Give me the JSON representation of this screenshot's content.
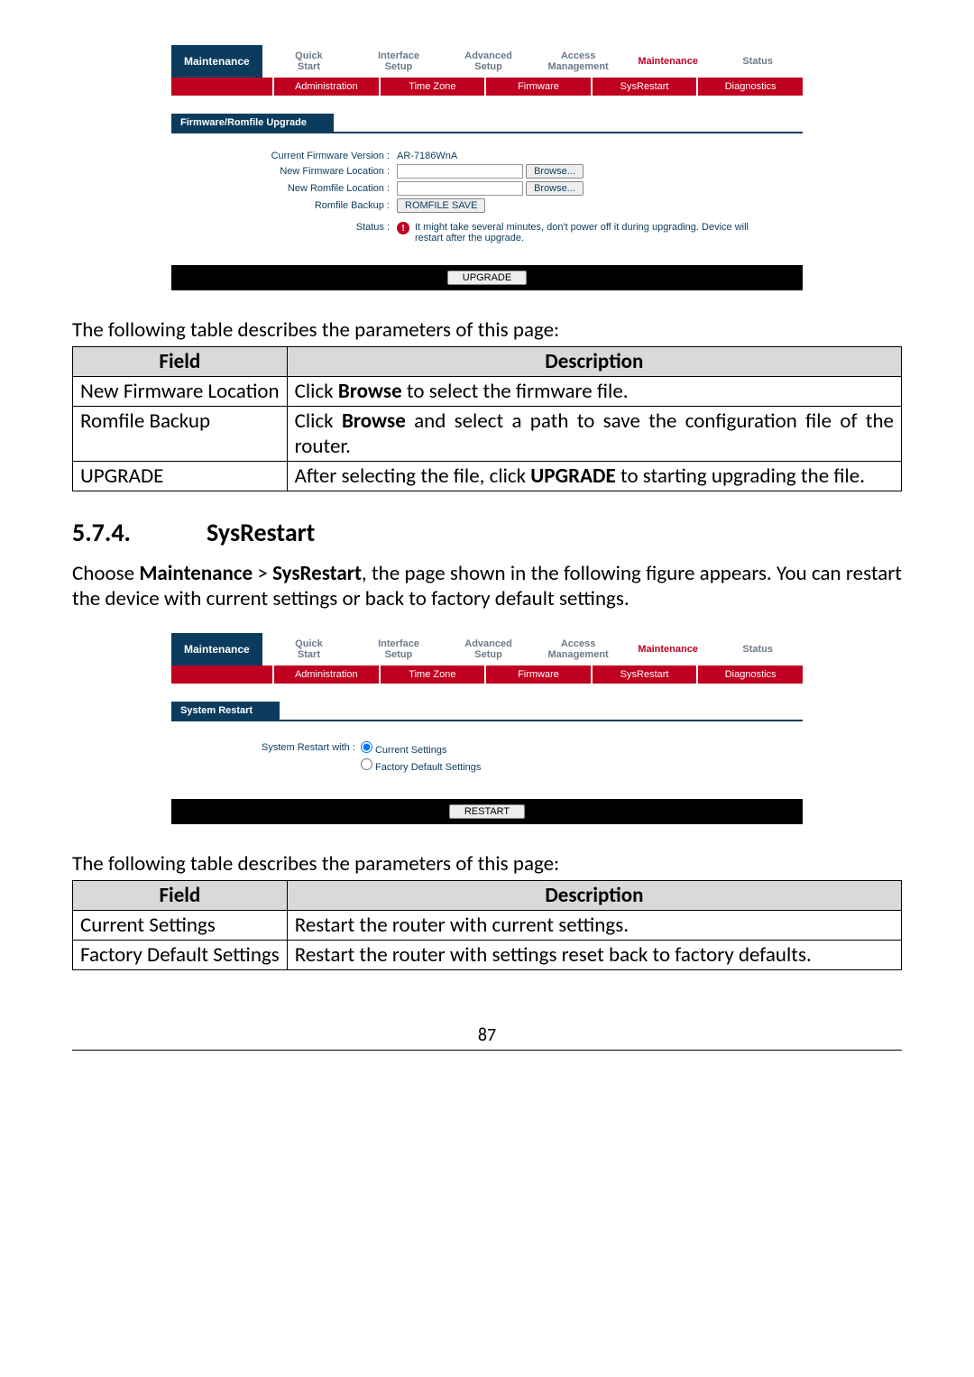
{
  "page_number": "87",
  "fw_ui": {
    "sidebar": "Maintenance",
    "tabs": [
      "Quick\nStart",
      "Interface\nSetup",
      "Advanced\nSetup",
      "Access\nManagement",
      "Maintenance",
      "Status"
    ],
    "tabs_active_index": 4,
    "subtabs": [
      "Administration",
      "Time Zone",
      "Firmware",
      "SysRestart",
      "Diagnostics"
    ],
    "section_title": "Firmware/Romfile Upgrade",
    "rows": {
      "current_version_label": "Current Firmware Version :",
      "current_version_value": "AR-7186WnA",
      "new_fw_label": "New Firmware Location :",
      "new_romfile_label": "New Romfile Location :",
      "romfile_backup_label": "Romfile Backup :",
      "status_label": "Status :",
      "browse_btn": "Browse...",
      "romfile_save_btn": "ROMFILE SAVE",
      "status_msg": "It might take several minutes, don't power off it during upgrading. Device will restart after the upgrade."
    },
    "upgrade_btn": "UPGRADE"
  },
  "intro1": "The following table describes the parameters of this page:",
  "table1": {
    "headers": [
      "Field",
      "Description"
    ],
    "rows": [
      {
        "field": "New Firmware Location",
        "desc_pre": "Click ",
        "desc_bold": "Browse",
        "desc_post": " to select the firmware file."
      },
      {
        "field": "Romfile Backup",
        "desc_pre": "Click ",
        "desc_bold": "Browse",
        "desc_post": " and select a path to save the configuration file of the router."
      },
      {
        "field": "UPGRADE",
        "desc_pre": "After selecting the file, click ",
        "desc_bold": "UPGRADE",
        "desc_post": " to starting upgrading the file."
      }
    ]
  },
  "heading": {
    "num": "5.7.4.",
    "title": "SysRestart"
  },
  "para1_parts": {
    "p1": "Choose ",
    "b1": "Maintenance",
    "p2": " > ",
    "b2": "SysRestart",
    "p3": ", the page shown in the following figure appears. You can restart the device with current settings or back to factory default settings."
  },
  "sr_ui": {
    "sidebar": "Maintenance",
    "tabs": [
      "Quick\nStart",
      "Interface\nSetup",
      "Advanced\nSetup",
      "Access\nManagement",
      "Maintenance",
      "Status"
    ],
    "tabs_active_index": 4,
    "subtabs": [
      "Administration",
      "Time Zone",
      "Firmware",
      "SysRestart",
      "Diagnostics"
    ],
    "section_title": "System Restart",
    "radio_label": "System Restart with :",
    "opt1": "Current Settings",
    "opt2": "Factory Default Settings",
    "restart_btn": "RESTART"
  },
  "intro2": "The following table describes the parameters of this page:",
  "table2": {
    "headers": [
      "Field",
      "Description"
    ],
    "rows": [
      {
        "field": "Current Settings",
        "desc": "Restart the router with current settings."
      },
      {
        "field": "Factory Default Settings",
        "desc": "Restart the router with settings reset back to factory defaults."
      }
    ]
  }
}
